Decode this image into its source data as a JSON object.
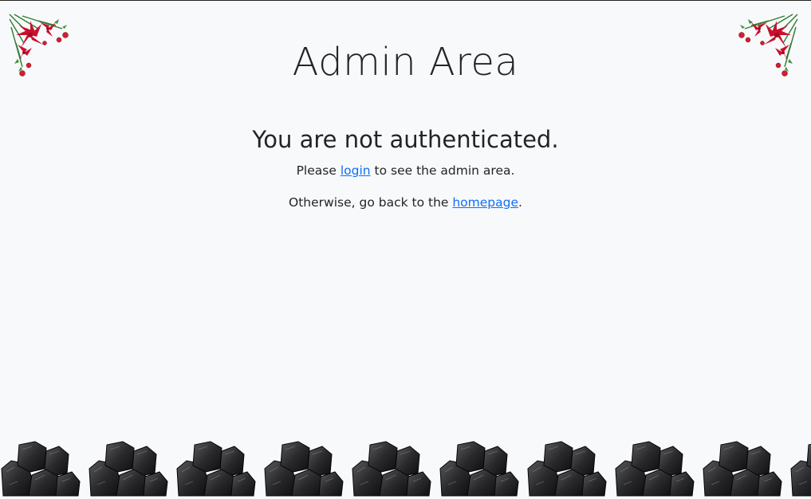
{
  "page": {
    "title": "Admin Area",
    "heading": "You are not authenticated.",
    "line1_prefix": "Please ",
    "login_link": "login",
    "line1_suffix": " to see the admin area.",
    "line2_prefix": "Otherwise, go back to the ",
    "homepage_link": "homepage",
    "line2_suffix": "."
  },
  "decorations": {
    "corner_icon": "poinsettia-holly-corner-icon",
    "footer_icon": "coal-lump-icon",
    "footer_count": 10
  },
  "colors": {
    "background": "#f8f9fa",
    "text": "#212529",
    "link": "#0d6efd",
    "poinsettia": "#c8102e",
    "pine": "#2e7d32",
    "coal": "#1c1c1e"
  }
}
